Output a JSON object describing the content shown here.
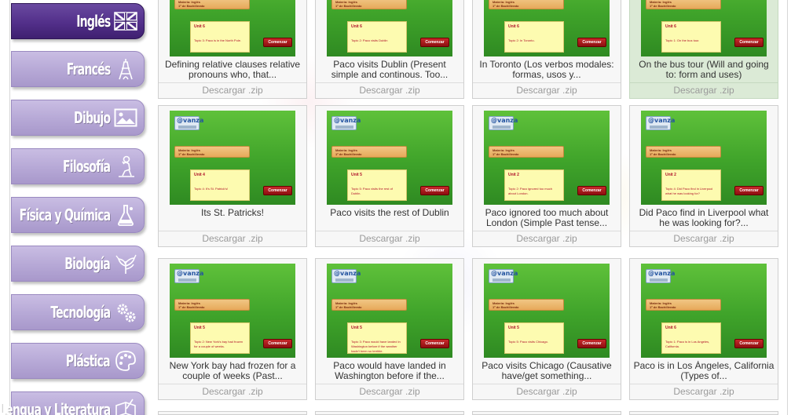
{
  "sidebar": {
    "items": [
      {
        "label": "Inglés",
        "icon": "uk-flag-icon",
        "active": true
      },
      {
        "label": "Francés",
        "icon": "eiffel-tower-icon",
        "active": false
      },
      {
        "label": "Dibujo",
        "icon": "picture-icon",
        "active": false
      },
      {
        "label": "Filosofía",
        "icon": "thinker-statue-icon",
        "active": false
      },
      {
        "label": "Física y Química",
        "icon": "flask-icon",
        "active": false
      },
      {
        "label": "Biología",
        "icon": "plant-icon",
        "active": false
      },
      {
        "label": "Tecnología",
        "icon": "gears-icon",
        "active": false
      },
      {
        "label": "Plástica",
        "icon": "palette-icon",
        "active": false
      },
      {
        "label": "Lengua y Literatura",
        "icon": "book-quill-icon",
        "active": false
      }
    ]
  },
  "thumb_common": {
    "logo": "@vanza",
    "subject": "Materia: Inglés",
    "course": "1º de Bachillerato",
    "start": "Comenzar"
  },
  "download_label": "Descargar .zip",
  "cards": [
    {
      "title": "Defining relative clauses relative pronouns who, that...",
      "unit": "Unit 6",
      "topic": "Topic 3: Paco is in the North Pole."
    },
    {
      "title": "Paco visits Dublin (Present simple and continous. Too...",
      "unit": "Unit 6",
      "topic": "Topic 2: Paco visits Dublin"
    },
    {
      "title": "In Toronto (Los verbos modales: formas, usos y...",
      "unit": "Unit 6",
      "topic": "Topic 2: In Toronto."
    },
    {
      "title": "On the bus tour (Will and going to: form and uses)",
      "unit": "Unit 6",
      "topic": "Topic 1: On the bus tour."
    },
    {
      "title": "Its St. Patricks!",
      "unit": "Unit 4",
      "topic": "Topic 4: It's St. Patrick's!"
    },
    {
      "title": "Paco visits the rest of Dublin",
      "unit": "Unit 5",
      "topic": "Topic 5: Paco visits the rest of Dublin."
    },
    {
      "title": "Paco ignored too much about London (Simple Past tense...",
      "unit": "Unit 2",
      "topic": "Topic 2: Paco ignored too much about London."
    },
    {
      "title": "Did Paco find in Liverpool what he was looking for?...",
      "unit": "Unit 2",
      "topic": "Topic 4: Did Paco find in Liverpool what he was looking for?"
    },
    {
      "title": "New York bay had frozen for a couple of weeks (Past...",
      "unit": "Unit 5",
      "topic": "Topic 2: New York's bay had frozen for a couple of weeks."
    },
    {
      "title": "Paco would have landed in Washington before if the...",
      "unit": "Unit 5",
      "topic": "Topic 3: Paco would have landed in Washington before if the weather hadn't been so terrible."
    },
    {
      "title": "Paco visits Chicago (Causative have/get something...",
      "unit": "Unit 5",
      "topic": "Topic 5: Paco visits Chicago."
    },
    {
      "title": "Paco is in Los Ángeles, California (Types of...",
      "unit": "Unit 6",
      "topic": "Topic 1: Paco is in Los Angeles, California."
    }
  ]
}
